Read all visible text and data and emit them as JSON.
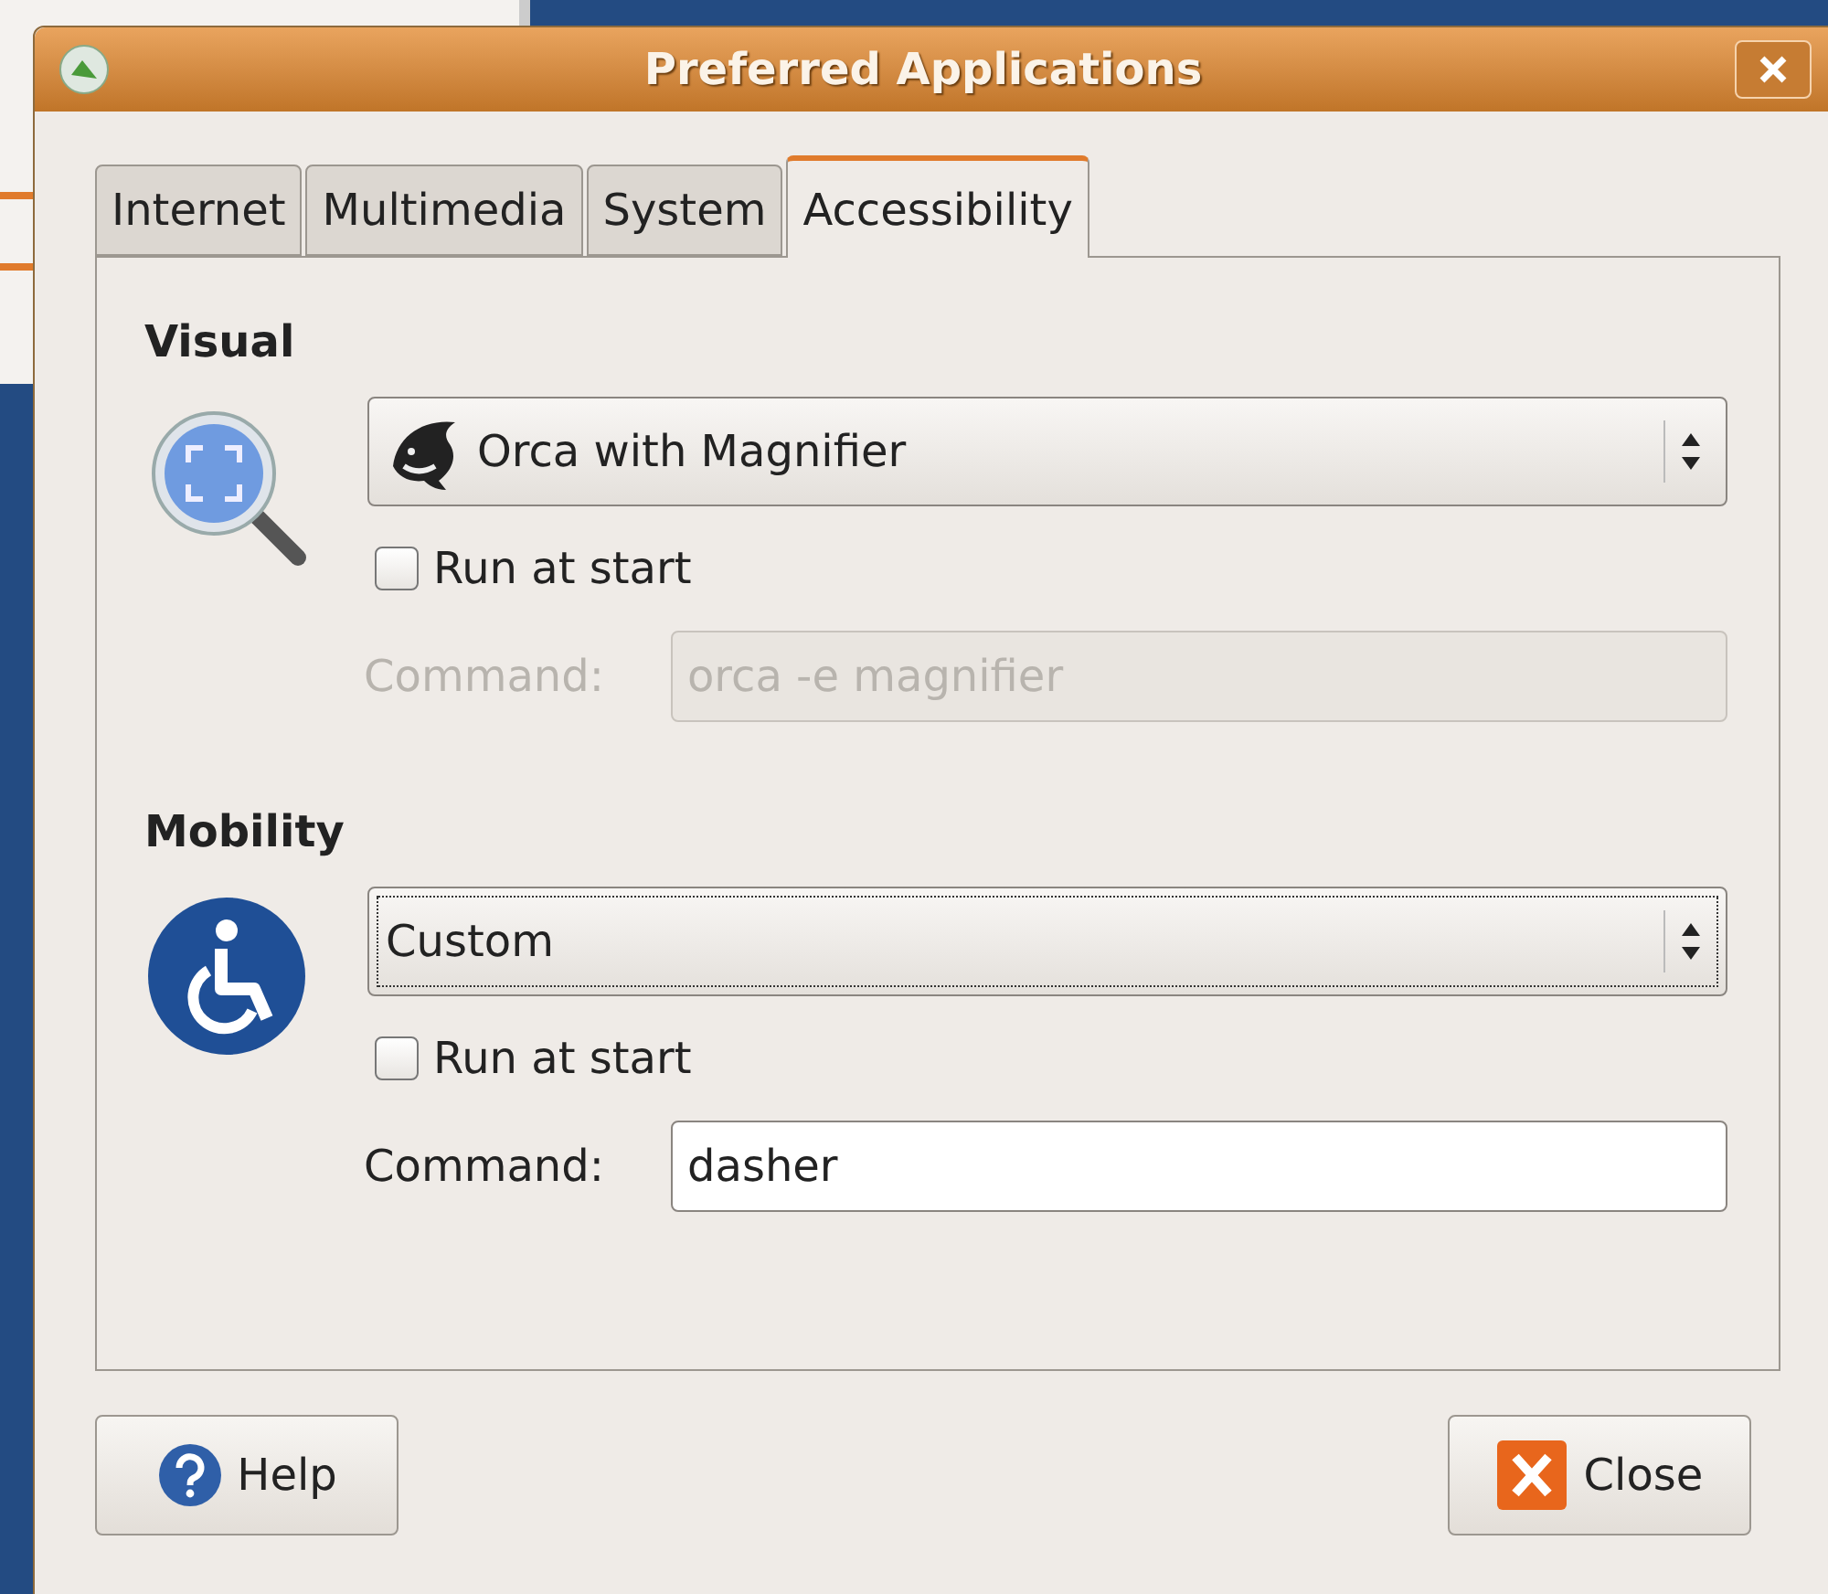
{
  "window": {
    "title": "Preferred Applications"
  },
  "tabs": [
    {
      "label": "Internet",
      "selected": false
    },
    {
      "label": "Multimedia",
      "selected": false
    },
    {
      "label": "System",
      "selected": false
    },
    {
      "label": "Accessibility",
      "selected": true
    }
  ],
  "sections": [
    {
      "kind": "visual",
      "title": "Visual",
      "combo": {
        "value": "Orca with Magnifier",
        "show_icon": true,
        "focused": false
      },
      "run_at_start": {
        "label": "Run at start",
        "checked": false
      },
      "command": {
        "label": "Command:",
        "value": "orca -e magnifier",
        "disabled": true
      }
    },
    {
      "kind": "mobility",
      "title": "Mobility",
      "combo": {
        "value": "Custom",
        "show_icon": false,
        "focused": true
      },
      "run_at_start": {
        "label": "Run at start",
        "checked": false
      },
      "command": {
        "label": "Command:",
        "value": "dasher",
        "disabled": false
      }
    }
  ],
  "buttons": [
    {
      "kind": "help",
      "label": "Help"
    },
    {
      "kind": "close",
      "label": "Close"
    }
  ]
}
